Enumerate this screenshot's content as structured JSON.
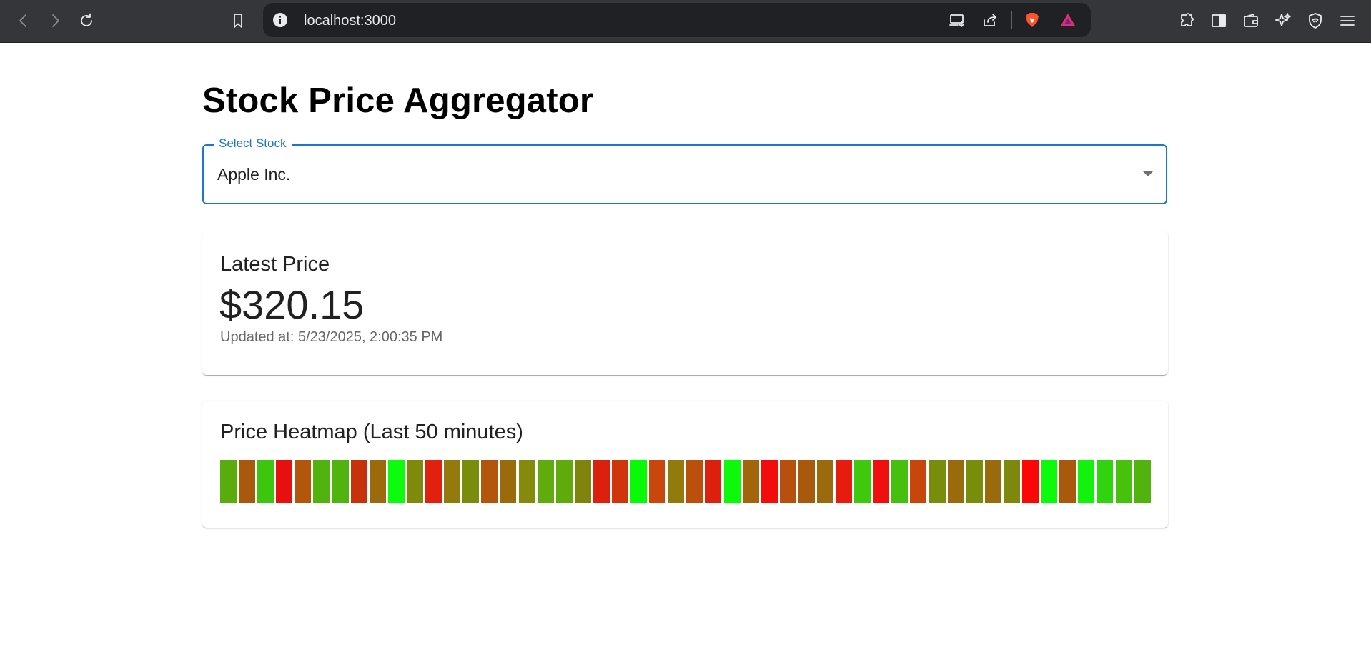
{
  "browser": {
    "url": "localhost:3000",
    "icons": [
      "back-icon",
      "forward-icon",
      "reload-icon",
      "bookmark-icon",
      "site-info-icon",
      "cast-icon",
      "share-icon",
      "brave-shields-icon",
      "brave-rewards-icon",
      "extensions-icon",
      "sidebar-icon",
      "wallet-icon",
      "leo-ai-icon",
      "vpn-icon",
      "menu-icon"
    ]
  },
  "page": {
    "title": "Stock Price Aggregator"
  },
  "select": {
    "label": "Select Stock",
    "value": "Apple Inc."
  },
  "latest": {
    "title": "Latest Price",
    "price": "$320.15",
    "updated": "Updated at: 5/23/2025, 2:00:35 PM"
  },
  "heatmap": {
    "title": "Price Heatmap (Last 50 minutes)",
    "cells": [
      "#5aab0c",
      "#a8590b",
      "#3ec50e",
      "#e8100e",
      "#b3560c",
      "#51b30e",
      "#52b20e",
      "#c7320c",
      "#9a6a0c",
      "#0dfb0d",
      "#7f890c",
      "#e1200e",
      "#947a0c",
      "#7a8c0c",
      "#b3560c",
      "#9b6a0c",
      "#868a0c",
      "#62ab0e",
      "#5fab0c",
      "#7f850c",
      "#dc200e",
      "#d0340c",
      "#08fa08",
      "#c9460c",
      "#937a0c",
      "#ba500c",
      "#dd1f0e",
      "#0cf90c",
      "#a2650c",
      "#f30c0c",
      "#b84f0c",
      "#a9590c",
      "#9b6a0c",
      "#e51c0e",
      "#3ec80e",
      "#f00e0e",
      "#46c00e",
      "#c7460c",
      "#798d0c",
      "#9a6a0c",
      "#798d0c",
      "#9a6b0c",
      "#7c890c",
      "#fb0707",
      "#0cfb0c",
      "#a9590c",
      "#12f20e",
      "#2fd40e",
      "#47c00e",
      "#51b30e"
    ]
  }
}
